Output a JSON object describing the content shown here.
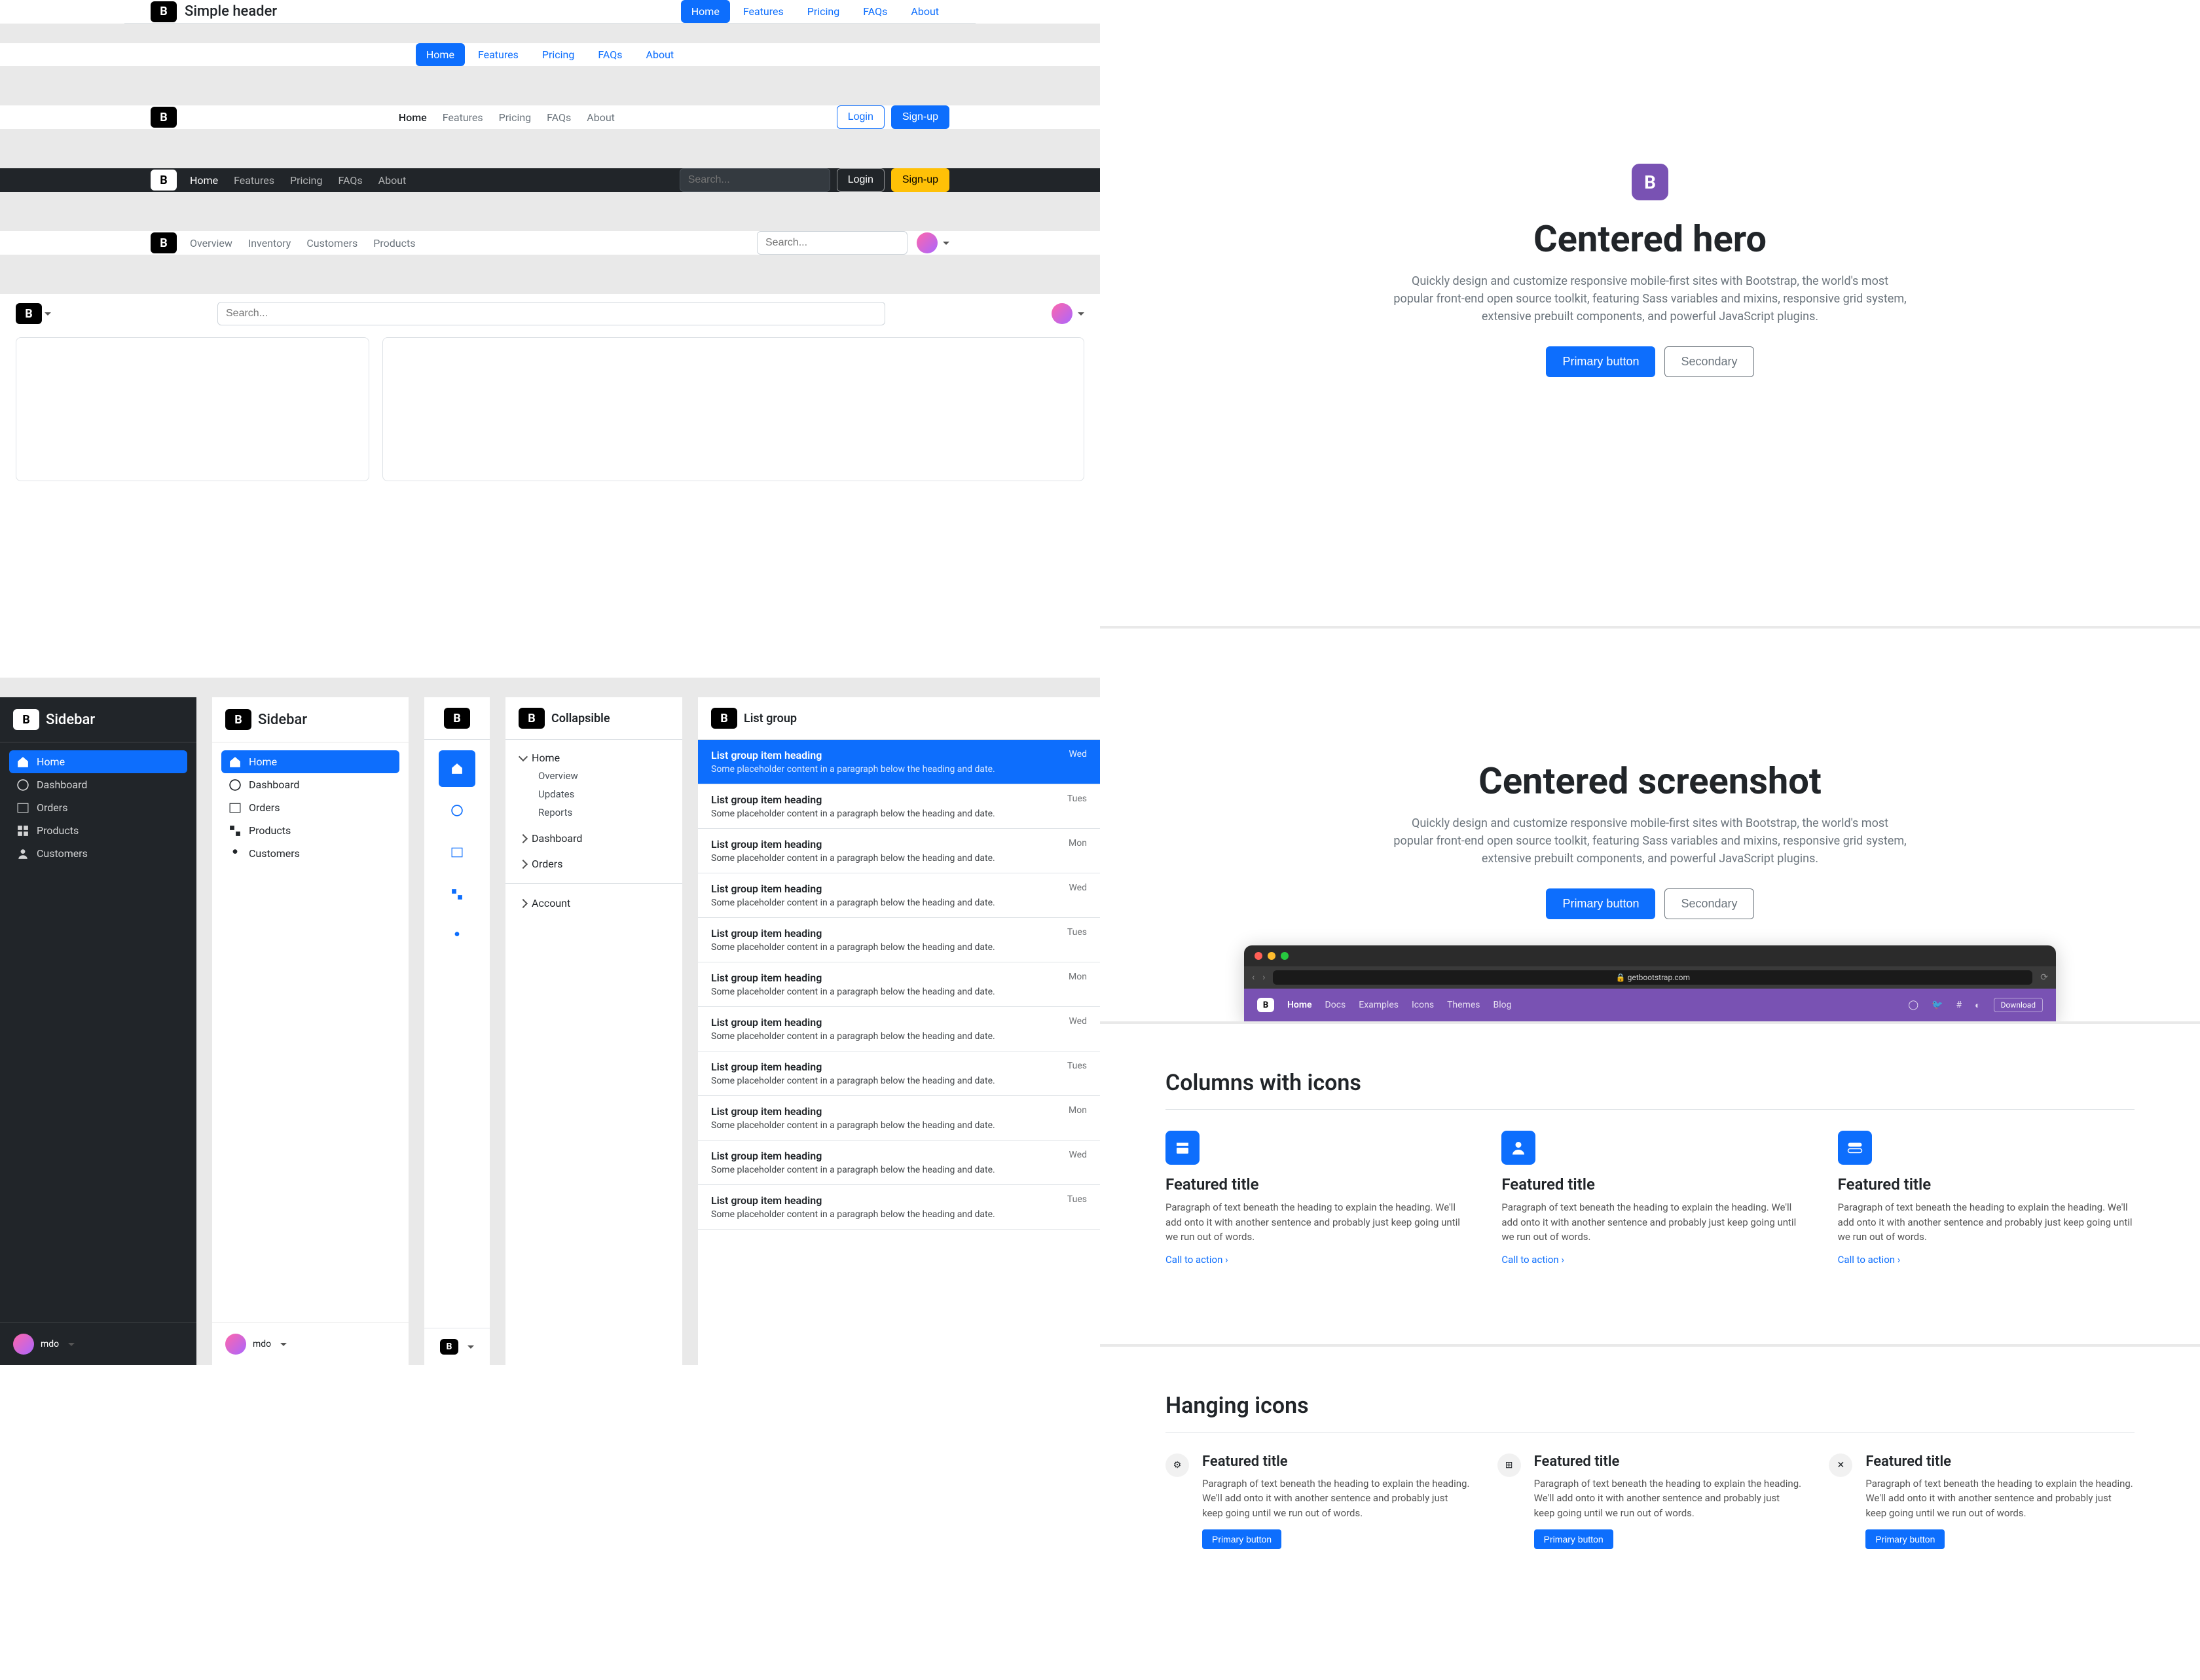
{
  "header1": {
    "brand": "Simple header",
    "nav": [
      "Home",
      "Features",
      "Pricing",
      "FAQs",
      "About"
    ]
  },
  "header2": {
    "nav": [
      "Home",
      "Features",
      "Pricing",
      "FAQs",
      "About"
    ]
  },
  "header3": {
    "nav": [
      "Home",
      "Features",
      "Pricing",
      "FAQs",
      "About"
    ],
    "login": "Login",
    "signup": "Sign-up"
  },
  "header4": {
    "nav": [
      "Home",
      "Features",
      "Pricing",
      "FAQs",
      "About"
    ],
    "search_ph": "Search...",
    "login": "Login",
    "signup": "Sign-up"
  },
  "header5": {
    "nav": [
      "Overview",
      "Inventory",
      "Customers",
      "Products"
    ],
    "search_ph": "Search..."
  },
  "header6": {
    "search_ph": "Search..."
  },
  "sidebar1": {
    "title": "Sidebar",
    "items": [
      "Home",
      "Dashboard",
      "Orders",
      "Products",
      "Customers"
    ],
    "user": "mdo"
  },
  "sidebar2": {
    "title": "Sidebar",
    "items": [
      "Home",
      "Dashboard",
      "Orders",
      "Products",
      "Customers"
    ],
    "user": "mdo"
  },
  "sidebar4": {
    "title": "Collapsible",
    "home": "Home",
    "home_sub": [
      "Overview",
      "Updates",
      "Reports"
    ],
    "dash": "Dashboard",
    "orders": "Orders",
    "account": "Account"
  },
  "sidebar5": {
    "title": "List group",
    "items": [
      {
        "h": "List group item heading",
        "p": "Some placeholder content in a paragraph below the heading and date.",
        "d": "Wed"
      },
      {
        "h": "List group item heading",
        "p": "Some placeholder content in a paragraph below the heading and date.",
        "d": "Tues"
      },
      {
        "h": "List group item heading",
        "p": "Some placeholder content in a paragraph below the heading and date.",
        "d": "Mon"
      },
      {
        "h": "List group item heading",
        "p": "Some placeholder content in a paragraph below the heading and date.",
        "d": "Wed"
      },
      {
        "h": "List group item heading",
        "p": "Some placeholder content in a paragraph below the heading and date.",
        "d": "Tues"
      },
      {
        "h": "List group item heading",
        "p": "Some placeholder content in a paragraph below the heading and date.",
        "d": "Mon"
      },
      {
        "h": "List group item heading",
        "p": "Some placeholder content in a paragraph below the heading and date.",
        "d": "Wed"
      },
      {
        "h": "List group item heading",
        "p": "Some placeholder content in a paragraph below the heading and date.",
        "d": "Tues"
      },
      {
        "h": "List group item heading",
        "p": "Some placeholder content in a paragraph below the heading and date.",
        "d": "Mon"
      },
      {
        "h": "List group item heading",
        "p": "Some placeholder content in a paragraph below the heading and date.",
        "d": "Wed"
      },
      {
        "h": "List group item heading",
        "p": "Some placeholder content in a paragraph below the heading and date.",
        "d": "Tues"
      }
    ]
  },
  "hero1": {
    "title": "Centered hero",
    "text": "Quickly design and customize responsive mobile-first sites with Bootstrap, the world's most popular front-end open source toolkit, featuring Sass variables and mixins, responsive grid system, extensive prebuilt components, and powerful JavaScript plugins.",
    "primary": "Primary button",
    "secondary": "Secondary"
  },
  "hero2": {
    "title": "Centered screenshot",
    "text": "Quickly design and customize responsive mobile-first sites with Bootstrap, the world's most popular front-end open source toolkit, featuring Sass variables and mixins, responsive grid system, extensive prebuilt components, and powerful JavaScript plugins.",
    "primary": "Primary button",
    "secondary": "Secondary",
    "addr": "getbootstrap.com",
    "sitelinks": [
      "Home",
      "Docs",
      "Examples",
      "Icons",
      "Themes",
      "Blog"
    ],
    "download": "Download"
  },
  "features1": {
    "heading": "Columns with icons",
    "cols": [
      {
        "t": "Featured title",
        "p": "Paragraph of text beneath the heading to explain the heading. We'll add onto it with another sentence and probably just keep going until we run out of words.",
        "cta": "Call to action"
      },
      {
        "t": "Featured title",
        "p": "Paragraph of text beneath the heading to explain the heading. We'll add onto it with another sentence and probably just keep going until we run out of words.",
        "cta": "Call to action"
      },
      {
        "t": "Featured title",
        "p": "Paragraph of text beneath the heading to explain the heading. We'll add onto it with another sentence and probably just keep going until we run out of words.",
        "cta": "Call to action"
      }
    ]
  },
  "features2": {
    "heading": "Hanging icons",
    "cols": [
      {
        "t": "Featured title",
        "p": "Paragraph of text beneath the heading to explain the heading. We'll add onto it with another sentence and probably just keep going until we run out of words.",
        "btn": "Primary button"
      },
      {
        "t": "Featured title",
        "p": "Paragraph of text beneath the heading to explain the heading. We'll add onto it with another sentence and probably just keep going until we run out of words.",
        "btn": "Primary button"
      },
      {
        "t": "Featured title",
        "p": "Paragraph of text beneath the heading to explain the heading. We'll add onto it with another sentence and probably just keep going until we run out of words.",
        "btn": "Primary button"
      }
    ]
  }
}
